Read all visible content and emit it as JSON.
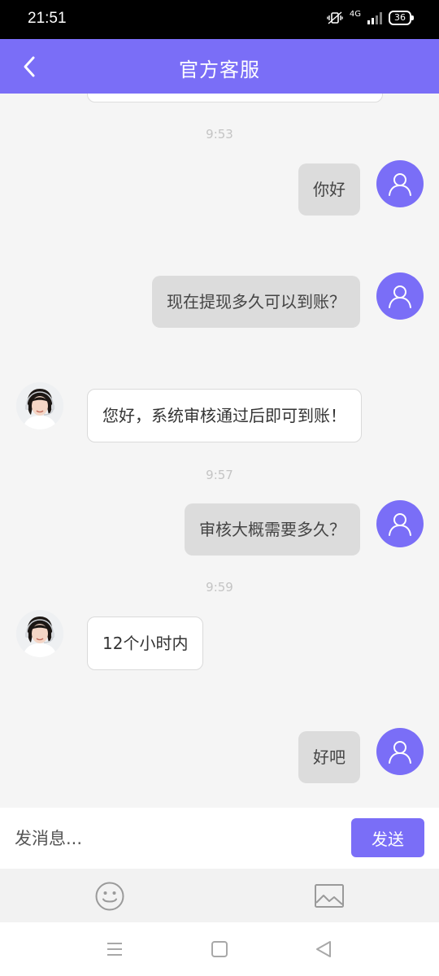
{
  "status_bar": {
    "time": "21:51",
    "network": "4G",
    "battery": "36"
  },
  "header": {
    "title": "官方客服",
    "back_icon": "chevron-left-icon",
    "background": "#7a6ef7"
  },
  "messages": [
    {
      "type": "time",
      "text": "9:53"
    },
    {
      "type": "user",
      "text": "你好"
    },
    {
      "type": "user",
      "text": "现在提现多久可以到账？"
    },
    {
      "type": "agent",
      "text": "您好，系统审核通过后即可到账！"
    },
    {
      "type": "time",
      "text": "9:57"
    },
    {
      "type": "user",
      "text": "审核大概需要多久？"
    },
    {
      "type": "time",
      "text": "9:59"
    },
    {
      "type": "agent",
      "text": "12个小时内"
    },
    {
      "type": "user",
      "text": "好吧"
    }
  ],
  "input": {
    "placeholder": "发消息...",
    "value": "",
    "send_label": "发送"
  },
  "toolbar": {
    "emoji_icon": "emoji-icon",
    "image_icon": "image-icon"
  },
  "colors": {
    "accent": "#7a6ef7",
    "user_bubble": "#dcdcdc",
    "agent_bubble": "#ffffff",
    "timestamp": "#c4c4c4"
  }
}
